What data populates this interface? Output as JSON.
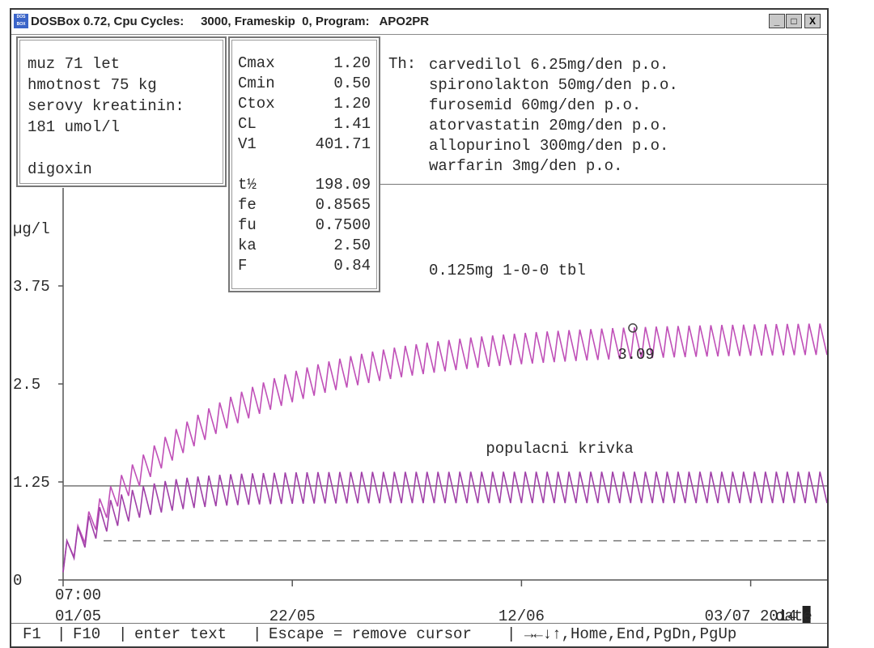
{
  "window": {
    "title": "DOSBox 0.72, Cpu Cycles:     3000, Frameskip  0, Program:   APO2PR",
    "icon_label": "DOS BOX",
    "controls": [
      "_",
      "□",
      "X"
    ]
  },
  "patient_panel": {
    "lines": [
      "muz 71 let",
      "hmotnost 75 kg",
      "serovy kreatinin:",
      "181 umol/l",
      "",
      "digoxin"
    ]
  },
  "params": [
    {
      "key": "Cmax",
      "value": "1.20"
    },
    {
      "key": "Cmin",
      "value": "0.50"
    },
    {
      "key": "Ctox",
      "value": "1.20"
    },
    {
      "key": "CL",
      "value": "1.41"
    },
    {
      "key": "V1",
      "value": "401.71"
    },
    {
      "key": "",
      "value": ""
    },
    {
      "key": "t½",
      "value": "198.09"
    },
    {
      "key": "fe",
      "value": "0.8565"
    },
    {
      "key": "fu",
      "value": "0.7500"
    },
    {
      "key": "ka",
      "value": "2.50"
    },
    {
      "key": "F",
      "value": "0.84"
    }
  ],
  "therapy": {
    "label": "Th:",
    "items": [
      "carvedilol 6.25mg/den p.o.",
      "spironolakton 50mg/den p.o.",
      "furosemid 60mg/den p.o.",
      "atorvastatin 20mg/den p.o.",
      "allopurinol 300mg/den p.o.",
      "warfarin 3mg/den p.o."
    ]
  },
  "dose_label": "0.125mg 1-0-0 tbl",
  "chart_data": {
    "type": "line",
    "ylabel": "µg/l",
    "y_ticks": [
      "3.75",
      "2.5",
      "1.25",
      "0"
    ],
    "ylim": [
      0,
      5
    ],
    "x_tick_times": [
      "07:00"
    ],
    "x_tick_dates": [
      "01/05",
      "22/05",
      "12/06",
      "03/07 2014"
    ],
    "x_unit_label": "date",
    "annotations": [
      "3.09",
      "populacni krivka"
    ],
    "reference_lines": [
      {
        "style": "solid",
        "value": 1.2
      },
      {
        "style": "dashed",
        "value": 0.5
      }
    ],
    "series": [
      {
        "color": "#c050b8",
        "start": 0.3,
        "steady_state": 3.09,
        "amplitude": 0.2,
        "tau_days": 14
      },
      {
        "color": "#a040a8",
        "start": 0.3,
        "steady_state": 1.18,
        "amplitude": 0.2,
        "tau_days": 4.5
      }
    ],
    "x_days": 70,
    "points_per_day": 1
  },
  "status_bar": {
    "items": [
      "F1",
      "F10",
      "enter text",
      "Escape = remove cursor",
      "→←↓↑,Home,End,PgDn,PgUp"
    ]
  },
  "colors": {
    "text": "#2a2a2a",
    "curve_upper": "#c050b8",
    "curve_lower": "#a040a8",
    "axis": "#555555"
  }
}
